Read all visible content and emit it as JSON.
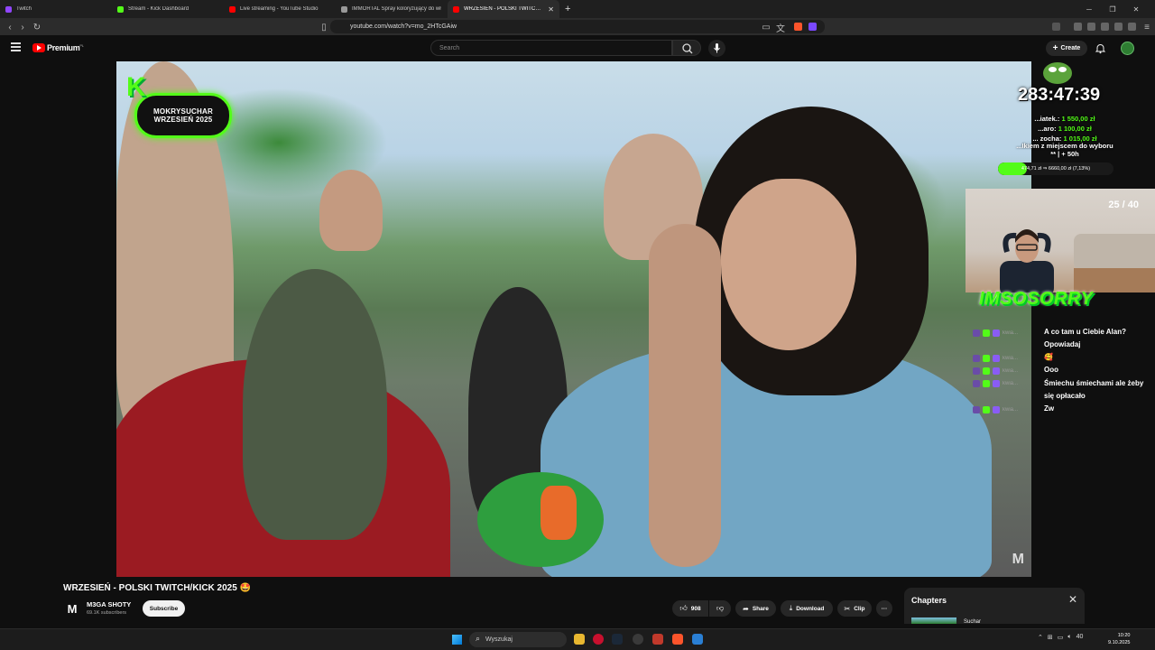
{
  "browser": {
    "tabs": [
      {
        "label": "Twitch",
        "color": "#9146ff",
        "active": false
      },
      {
        "label": "Stream - Kick Dashboard",
        "color": "#53fc18",
        "active": false
      },
      {
        "label": "Live streaming - YouTube Studio",
        "color": "#ff0000",
        "active": false
      },
      {
        "label": "IMMORTAL Spray koloryzujący do wł",
        "color": "#999999",
        "active": false
      },
      {
        "label": "WRZESIEŃ - POLSKI TWITCH/...",
        "color": "#ff0000",
        "active": true
      }
    ],
    "new_tab": "+",
    "url": "youtube.com/watch?v=mo_2HTcGAiw"
  },
  "youtube": {
    "brand": "Premium",
    "brand_sup": "PL",
    "search_placeholder": "Search",
    "create_label": "Create"
  },
  "video": {
    "logo_line1": "MOKRYSUCHAR",
    "logo_line2": "WRZESIEŃ 2025",
    "logo_k": "K",
    "watermark": "M"
  },
  "overlay": {
    "timer": "283:47:39",
    "goals": [
      {
        "prefix": "...iatek.: ",
        "amount": "1 550,00 zł",
        "suffix": ""
      },
      {
        "prefix": "...aro: ",
        "amount": "1 100,00 zł",
        "suffix": ""
      },
      {
        "prefix": "... zocha: ",
        "amount": "1 015,00 zł",
        "suffix": ""
      },
      {
        "prefix": "",
        "amount": "",
        "suffix": "...Ikiem z miejscem do wyboru"
      },
      {
        "prefix": "",
        "amount": "",
        "suffix": "** | + 50h"
      }
    ],
    "progress_label": "474,71 zł ⇒ 6660,00 zł (7,13%)",
    "progress_pct": 7.13,
    "webcam_counter": "25 / 40",
    "banner": "IMSOSORRY"
  },
  "chat": {
    "names": [
      "kwia...",
      "kwia...",
      "kwia...",
      "kwia...",
      "kwia..."
    ],
    "messages": [
      {
        "text": "A co tam u Ciebie Alan? Opowiadaj"
      },
      {
        "text": "🥰"
      },
      {
        "text": "Ooo"
      },
      {
        "text": "Śmiechu śmiechami ale żeby się opłacało"
      },
      {
        "text": "Zw"
      }
    ]
  },
  "watch": {
    "title": "WRZESIEŃ - POLSKI TWITCH/KICK 2025 🤩",
    "channel": "M3GA SHOTY",
    "subscribers": "69.1K subscribers",
    "subscribe_label": "Subscribe",
    "likes": "908",
    "share_label": "Share",
    "download_label": "Download",
    "clip_label": "Clip",
    "more_label": "···"
  },
  "chapters": {
    "title": "Chapters",
    "first": "Suchar"
  },
  "taskbar": {
    "search_placeholder": "Wyszukaj",
    "time": "10:20",
    "date": "9.10.2025",
    "volume": "40"
  }
}
